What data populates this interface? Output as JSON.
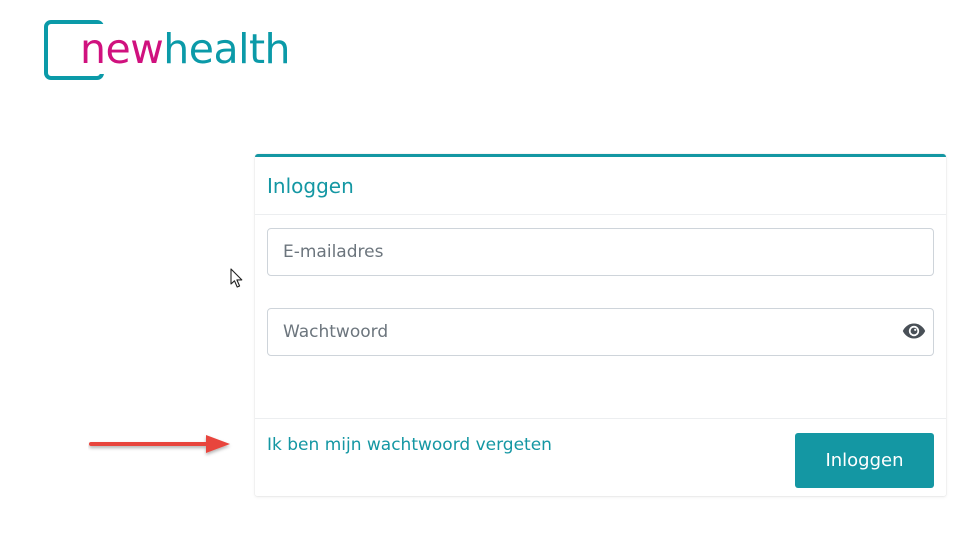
{
  "logo": {
    "part1": "new",
    "part2": "health",
    "colors": {
      "magenta": "#d0117e",
      "teal": "#0b9aa8"
    }
  },
  "login_card": {
    "title": "Inloggen",
    "email": {
      "placeholder": "E-mailadres",
      "value": ""
    },
    "password": {
      "placeholder": "Wachtwoord",
      "value": "",
      "toggle_icon": "eye-icon"
    },
    "forgot_link": "Ik ben mijn wachtwoord vergeten",
    "submit_label": "Inloggen",
    "accent_color": "#1497a3"
  },
  "annotation": {
    "icon": "red-arrow-right-icon",
    "color": "#e8453c"
  }
}
